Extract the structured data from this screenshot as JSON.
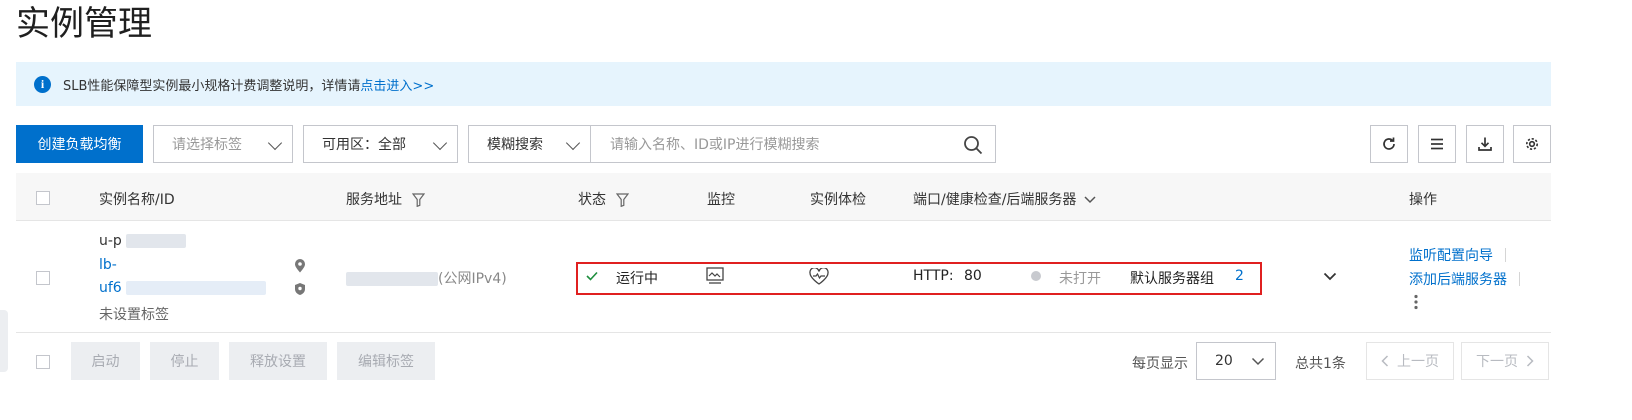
{
  "page": {
    "title": "实例管理"
  },
  "notice": {
    "text": "SLB性能保障型实例最小规格计费调整说明，详情请",
    "link": "点击进入>>"
  },
  "toolbar": {
    "create_button": "创建负载均衡",
    "tag_select_placeholder": "请选择标签",
    "zone_select": "可用区：全部",
    "search_mode": "模糊搜索",
    "search_placeholder": "请输入名称、ID或IP进行模糊搜索",
    "icons": [
      "refresh-icon",
      "list-icon",
      "download-icon",
      "settings-icon"
    ]
  },
  "table": {
    "headers": {
      "name": "实例名称/ID",
      "address": "服务地址",
      "status": "状态",
      "monitor": "监控",
      "health": "实例体检",
      "ports": "端口/健康检查/后端服务器",
      "actions": "操作"
    },
    "rows": [
      {
        "name_prefix": "u-p",
        "id_line1": "lb-",
        "id_line2": "uf6",
        "tag": "未设置标签",
        "address_suffix": "(公网IPv4)",
        "status": "运行中",
        "protocol": "HTTP:",
        "port": "80",
        "health_check": "未打开",
        "server_group": "默认服务器组",
        "server_count": "2",
        "action_1": "监听配置向导",
        "action_2": "添加后端服务器"
      }
    ]
  },
  "footer": {
    "buttons": [
      "启动",
      "停止",
      "释放设置",
      "编辑标签"
    ],
    "per_page_label": "每页显示",
    "per_page_value": "20",
    "total": "总共1条",
    "prev": "上一页",
    "next": "下一页"
  },
  "colors": {
    "primary": "#0070cc",
    "highlight": "#e02020",
    "success": "#1e8e3e"
  }
}
